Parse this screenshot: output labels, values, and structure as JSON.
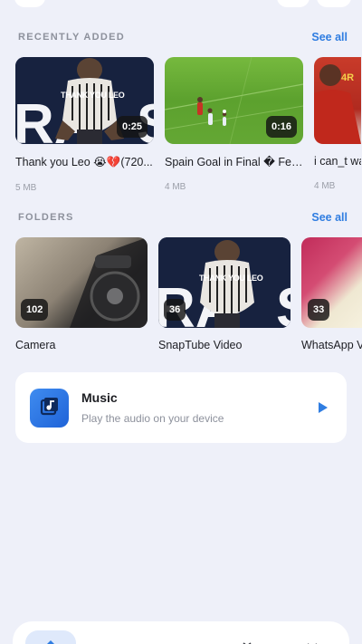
{
  "recent": {
    "title": "RECENTLY ADDED",
    "see_all": "See all",
    "items": [
      {
        "title": "Thank you Leo 😭💔(720...",
        "size": "5 MB",
        "duration": "0:25",
        "overlay_text": "THANK YOU LEO"
      },
      {
        "title": "Spain Goal in Final � Fer...",
        "size": "4 MB",
        "duration": "0:16"
      },
      {
        "title": "i can_t wa",
        "size": "4 MB"
      }
    ]
  },
  "folders": {
    "title": "FOLDERS",
    "see_all": "See all",
    "items": [
      {
        "name": "Camera",
        "count": "102"
      },
      {
        "name": "SnapTube Video",
        "count": "36",
        "overlay_text": "THANK YOU LEO"
      },
      {
        "name": "WhatsApp V",
        "count": "33"
      }
    ]
  },
  "music": {
    "title": "Music",
    "subtitle": "Play the audio on your device",
    "accent": "#2f7de1"
  },
  "nav": {
    "items": [
      "home-icon",
      "video-icon",
      "music-icon",
      "tv-icon",
      "more-icon"
    ],
    "active": "home-icon"
  },
  "colors": {
    "background": "#eef0f9",
    "accent": "#2f7de1",
    "card": "#ffffff"
  }
}
